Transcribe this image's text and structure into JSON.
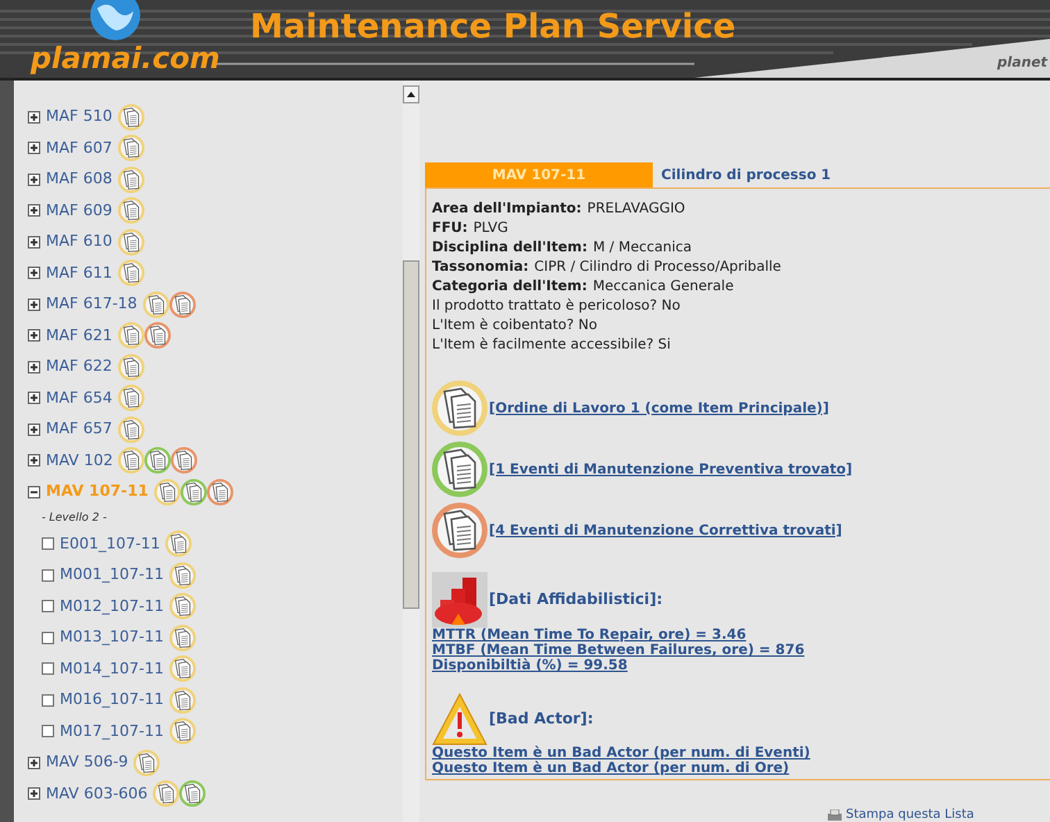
{
  "header": {
    "logo": "plamai.com",
    "title": "Maintenance Plan Service",
    "brand": "planet"
  },
  "tree": [
    {
      "label": "MAF 510",
      "expanded": false,
      "selected": false,
      "docs": [
        {
          "color": "#f0d27a"
        }
      ]
    },
    {
      "label": "MAF 607",
      "expanded": false,
      "selected": false,
      "docs": [
        {
          "color": "#f0d27a"
        }
      ]
    },
    {
      "label": "MAF 608",
      "expanded": false,
      "selected": false,
      "docs": [
        {
          "color": "#f0d27a"
        }
      ]
    },
    {
      "label": "MAF 609",
      "expanded": false,
      "selected": false,
      "docs": [
        {
          "color": "#f0d27a"
        }
      ]
    },
    {
      "label": "MAF 610",
      "expanded": false,
      "selected": false,
      "docs": [
        {
          "color": "#f0d27a"
        }
      ]
    },
    {
      "label": "MAF 611",
      "expanded": false,
      "selected": false,
      "docs": [
        {
          "color": "#f0d27a"
        }
      ]
    },
    {
      "label": "MAF 617-18",
      "expanded": false,
      "selected": false,
      "docs": [
        {
          "color": "#f0d27a"
        },
        {
          "color": "#e8946a"
        }
      ]
    },
    {
      "label": "MAF 621",
      "expanded": false,
      "selected": false,
      "docs": [
        {
          "color": "#f0d27a"
        },
        {
          "color": "#e8946a"
        }
      ]
    },
    {
      "label": "MAF 622",
      "expanded": false,
      "selected": false,
      "docs": [
        {
          "color": "#f0d27a"
        }
      ]
    },
    {
      "label": "MAF 654",
      "expanded": false,
      "selected": false,
      "docs": [
        {
          "color": "#f0d27a"
        }
      ]
    },
    {
      "label": "MAF 657",
      "expanded": false,
      "selected": false,
      "docs": [
        {
          "color": "#f0d27a"
        }
      ]
    },
    {
      "label": "MAV 102",
      "expanded": false,
      "selected": false,
      "docs": [
        {
          "color": "#f0d27a"
        },
        {
          "color": "#8cc85a"
        },
        {
          "color": "#e8946a"
        }
      ]
    },
    {
      "label": "MAV 107-11",
      "expanded": true,
      "selected": true,
      "docs": [
        {
          "color": "#f0d27a"
        },
        {
          "color": "#8cc85a"
        },
        {
          "color": "#e8946a"
        }
      ],
      "level_label": "- Levello 2 -",
      "children": [
        {
          "label": "E001_107-11",
          "selected": false,
          "checked": false,
          "docs": [
            {
              "color": "#f0d27a"
            }
          ]
        },
        {
          "label": "M001_107-11",
          "selected": false,
          "checked": false,
          "docs": [
            {
              "color": "#f0d27a"
            }
          ]
        },
        {
          "label": "M012_107-11",
          "selected": false,
          "checked": false,
          "docs": [
            {
              "color": "#f0d27a"
            }
          ]
        },
        {
          "label": "M013_107-11",
          "selected": false,
          "checked": false,
          "docs": [
            {
              "color": "#f0d27a"
            }
          ]
        },
        {
          "label": "M014_107-11",
          "selected": false,
          "checked": false,
          "docs": [
            {
              "color": "#f0d27a"
            }
          ]
        },
        {
          "label": "M016_107-11",
          "selected": false,
          "checked": false,
          "docs": [
            {
              "color": "#f0d27a"
            }
          ]
        },
        {
          "label": "M017_107-11",
          "selected": false,
          "checked": false,
          "docs": [
            {
              "color": "#f0d27a"
            }
          ]
        }
      ]
    },
    {
      "label": "MAV 506-9",
      "expanded": false,
      "selected": false,
      "docs": [
        {
          "color": "#f0d27a"
        }
      ]
    },
    {
      "label": "MAV 603-606",
      "expanded": false,
      "selected": false,
      "docs": [
        {
          "color": "#f0d27a"
        },
        {
          "color": "#8cc85a"
        }
      ]
    }
  ],
  "detail": {
    "code": "MAV 107-11",
    "title": "Cilindro di processo 1",
    "properties": [
      {
        "label": "Area dell'Impianto:",
        "value": "PRELAVAGGIO"
      },
      {
        "label": "FFU:",
        "value": "PLVG"
      },
      {
        "label": "Disciplina dell'Item:",
        "value": "M / Meccanica"
      },
      {
        "label": "Tassonomia:",
        "value": "CIPR / Cilindro di Processo/Apriballe"
      },
      {
        "label": "Categoria dell'Item:",
        "value": "Meccanica Generale"
      },
      {
        "value": "Il prodotto trattato è pericoloso? No"
      },
      {
        "value": "L'Item è coibentato? No"
      },
      {
        "value": "L'Item è facilmente accessibile? Si"
      }
    ],
    "sections": [
      {
        "kind": "document",
        "color": "#f0d27a",
        "links": [
          "[Ordine di Lavoro 1 (come Item Principale)]"
        ]
      },
      {
        "kind": "document",
        "color": "#8cc85a",
        "links": [
          "[1 Eventi di Manutenzione Preventiva trovato]"
        ]
      },
      {
        "kind": "document",
        "color": "#e8946a",
        "links": [
          "[4 Eventi di Manutenzione Correttiva trovati]"
        ]
      },
      {
        "kind": "chart",
        "heading": "[Dati Affidabilistici]:",
        "links": [
          "MTTR (Mean Time To Repair, ore) = 3.46",
          "MTBF (Mean Time Between Failures, ore) = 876",
          "Disponibiltià (%) = 99.58"
        ]
      },
      {
        "kind": "warning",
        "heading": "[Bad Actor]:",
        "links": [
          "Questo Item è un Bad Actor (per num. di Eventi)",
          "Questo Item è un Bad Actor (per num. di Ore)"
        ]
      }
    ]
  },
  "print_link": "Stampa questa Lista"
}
